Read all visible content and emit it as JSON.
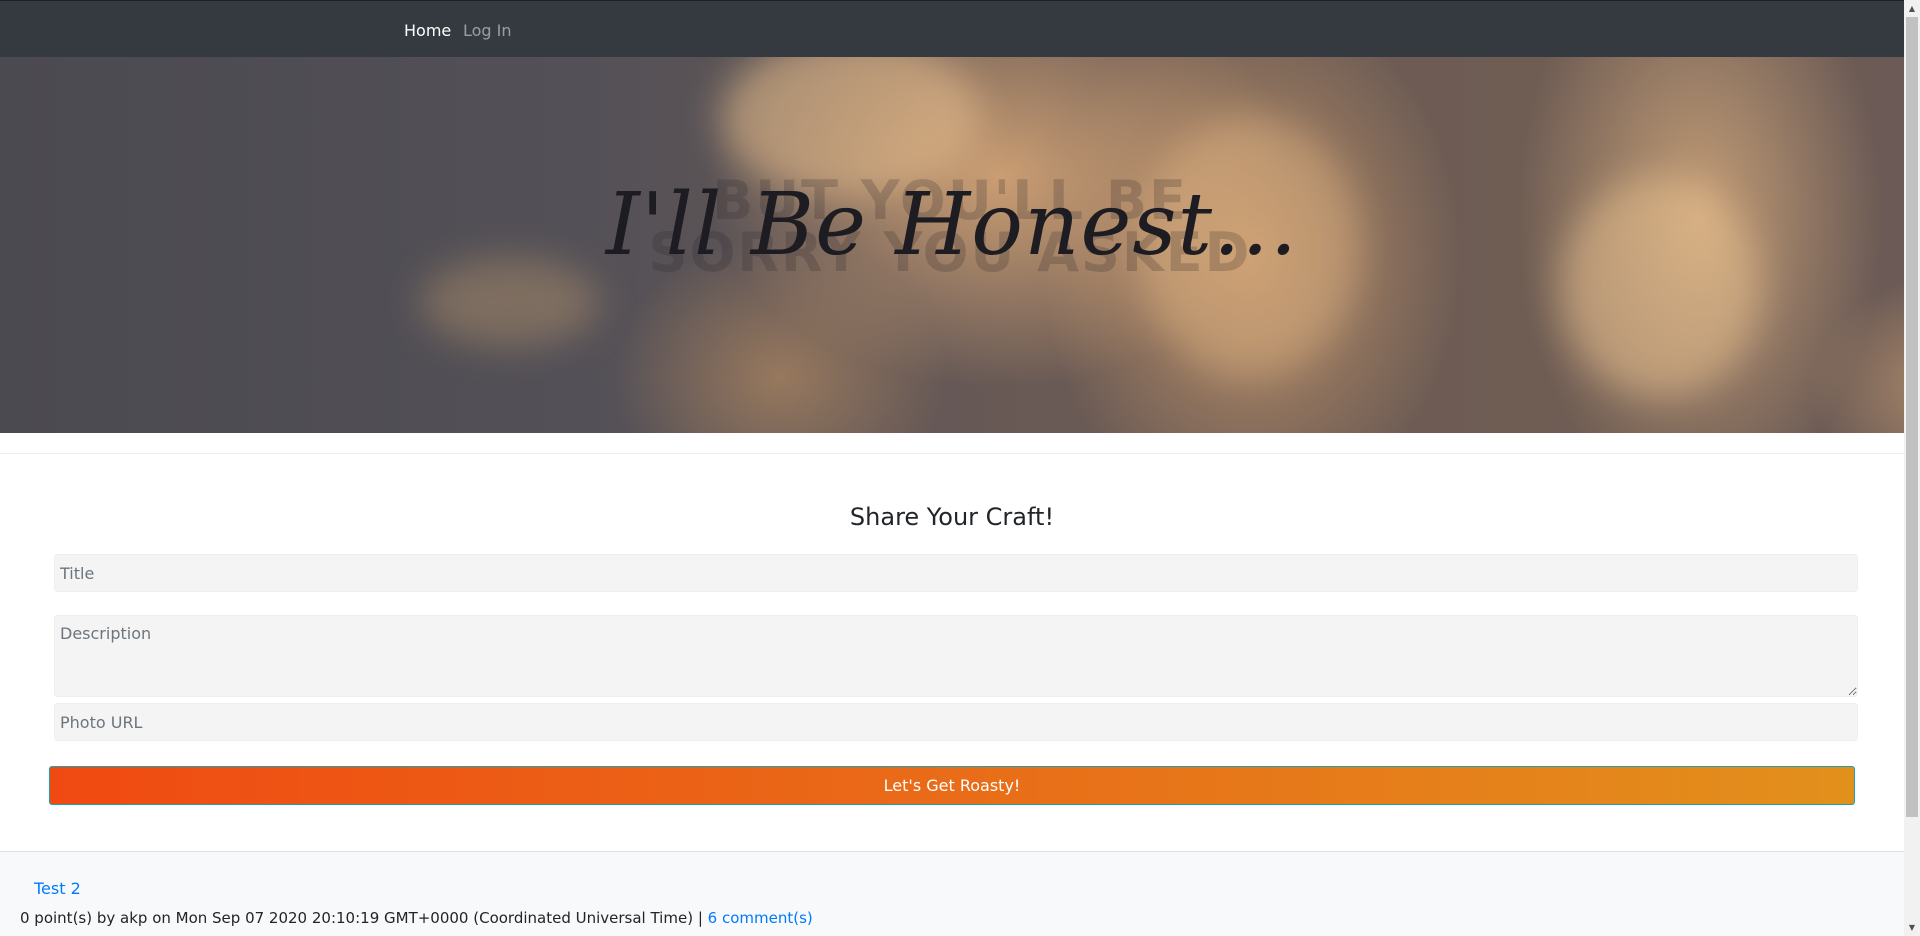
{
  "nav": {
    "home_label": "Home",
    "login_label": "Log In"
  },
  "hero": {
    "title": "I'll Be Honest...",
    "background_line_1": "BUT YOU'LL BE",
    "background_line_2": "SORRY YOU ASKED"
  },
  "form": {
    "heading": "Share Your Craft!",
    "title_placeholder": "Title",
    "description_placeholder": "Description",
    "photo_placeholder": "Photo URL",
    "submit_label": "Let's Get Roasty!"
  },
  "posts": [
    {
      "title": "Test 2",
      "meta": "0 point(s) by akp on Mon Sep 07 2020 20:10:19 GMT+0000 (Coordinated Universal Time) |",
      "comments_label": "6 comment(s)"
    }
  ],
  "colors": {
    "navbar": "#343a40",
    "button_gradient_start": "#f04a12",
    "button_gradient_end": "#e2901c",
    "link": "#007bff"
  },
  "icons": {
    "scroll_up": "triangle-up-icon",
    "scroll_down": "triangle-down-icon"
  }
}
